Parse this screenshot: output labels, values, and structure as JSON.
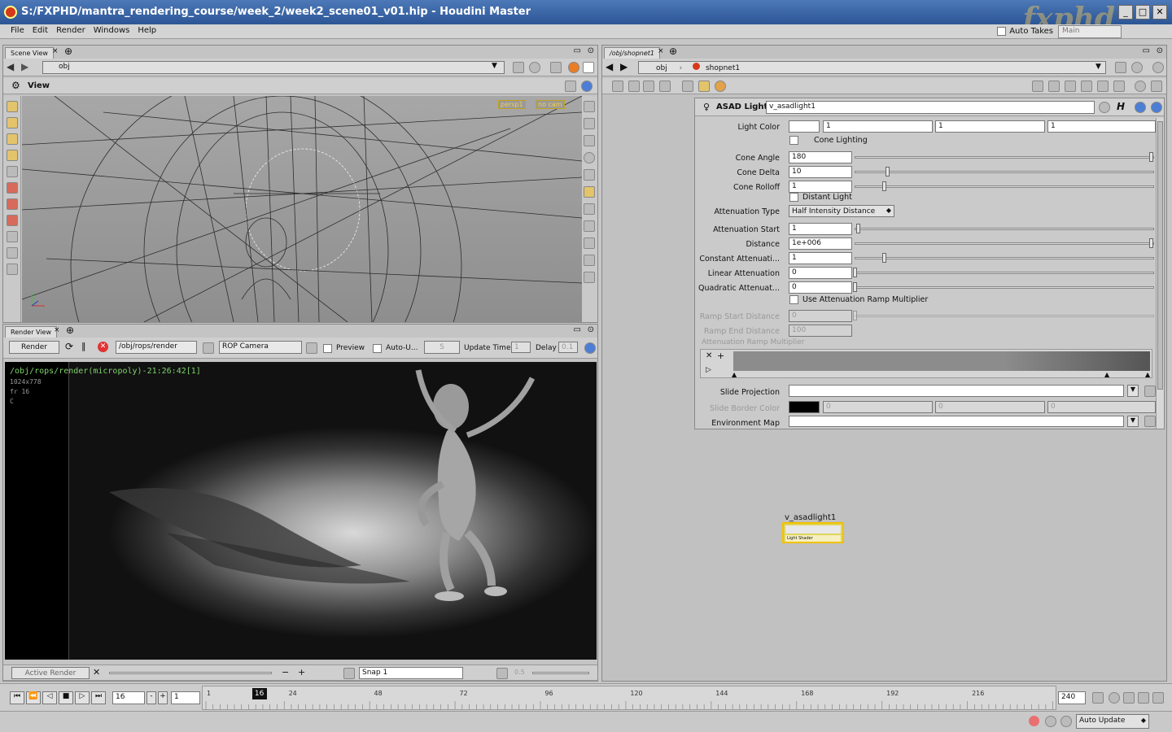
{
  "window": {
    "title": "S:/FXPHD/mantra_rendering_course/week_2/week2_scene01_v01.hip - Houdini Master",
    "logo": "fxphd"
  },
  "menu": [
    "File",
    "Edit",
    "Render",
    "Windows",
    "Help"
  ],
  "top_right": {
    "auto_takes": "Auto Takes",
    "take": "Main"
  },
  "scene_view": {
    "tab": "Scene View",
    "path": "obj",
    "view_label": "View",
    "persp": "persp1",
    "cam": "no cam"
  },
  "render_view": {
    "tab": "Render View",
    "render_btn": "Render",
    "rop_path": "/obj/rops/render",
    "camera": "ROP Camera",
    "preview": "Preview",
    "auto_update": "Auto-U...",
    "update_time": "Update Time",
    "update_time_val": "1",
    "delay": "Delay",
    "delay_val": "0.1",
    "overlay": {
      "path": "/obj/rops/render(micropoly)-21:26:42[1]",
      "res": "1024x778",
      "frame": "fr 16",
      "ch": "C"
    },
    "bottom_mode": "Active Render",
    "snap": "Snap 1",
    "gamma": "0.5"
  },
  "network": {
    "tab": "/obj/shopnet1",
    "crumb_obj": "obj",
    "crumb_node": "shopnet1",
    "node_name": "v_asadlight1",
    "node_label": "Light Shader"
  },
  "params": {
    "type_label": "ASAD Light",
    "name": "v_asadlight1",
    "rows": [
      {
        "label": "Light Color",
        "vals": [
          "",
          "1",
          "1",
          "1"
        ]
      },
      {
        "label": "Cone Lighting",
        "type": "check"
      },
      {
        "label": "Cone Angle",
        "val": "180",
        "pos": 1.0
      },
      {
        "label": "Cone Delta",
        "val": "10",
        "pos": 0.11
      },
      {
        "label": "Cone Rolloff",
        "val": "1",
        "pos": 0.1
      },
      {
        "label": "Distant Light",
        "type": "check"
      },
      {
        "label": "Attenuation Type",
        "menu": "Half Intensity Distance"
      },
      {
        "label": "Attenuation Start",
        "val": "1",
        "pos": 0.01
      },
      {
        "label": "Distance",
        "val": "1e+006",
        "pos": 1.0
      },
      {
        "label": "Constant Attenuati...",
        "val": "1",
        "pos": 0.1
      },
      {
        "label": "Linear Attenuation",
        "val": "0",
        "pos": 0
      },
      {
        "label": "Quadratic Attenuat...",
        "val": "0",
        "pos": 0
      },
      {
        "label": "Use Attenuation Ramp Multiplier",
        "type": "check"
      },
      {
        "label": "Ramp Start Distance",
        "val": "0",
        "pos": 0,
        "dim": true
      },
      {
        "label": "Ramp End Distance",
        "val": "100",
        "dim": true
      }
    ],
    "ramp_label": "Attenuation Ramp Multiplier",
    "slide_projection": "Slide Projection",
    "slide_border": "Slide Border Color",
    "slide_border_vals": [
      "0",
      "0",
      "0"
    ],
    "env_map": "Environment Map"
  },
  "timeline": {
    "frame": "16",
    "step": "1",
    "end": "240",
    "ticks": [
      "1",
      "24",
      "48",
      "72",
      "96",
      "120",
      "144",
      "168",
      "192",
      "216"
    ],
    "marker": "16",
    "auto_update": "Auto Update"
  }
}
